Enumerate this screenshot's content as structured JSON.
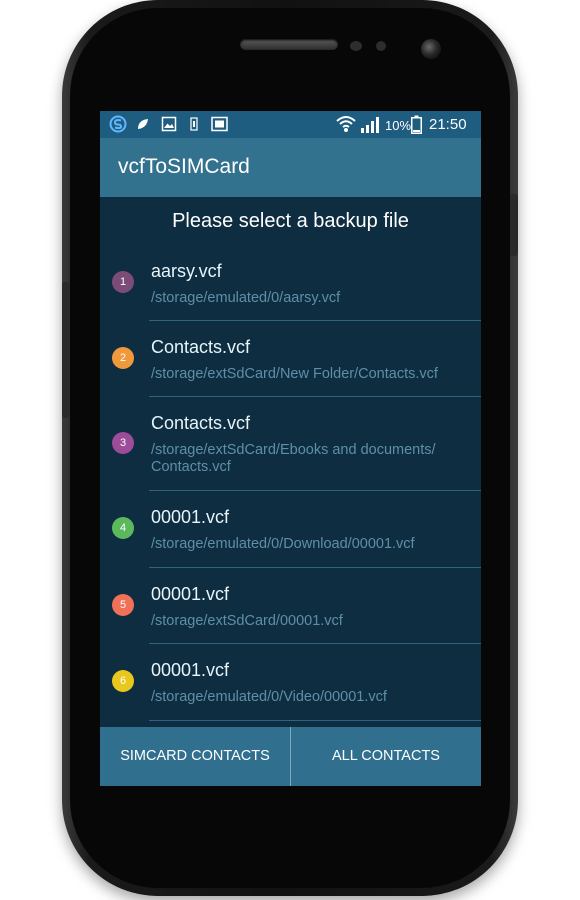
{
  "status_bar": {
    "time": "21:50",
    "battery": "10%",
    "icons": [
      "s-app-icon",
      "leaf-icon",
      "image-icon",
      "battery-saver-icon",
      "screenshot-icon",
      "wifi-icon",
      "signal-icon",
      "battery-icon"
    ]
  },
  "app": {
    "title": "vcfToSIMCard"
  },
  "prompt": "Please select a backup file",
  "files": [
    {
      "number": "1",
      "name": "aarsy.vcf",
      "path": "/storage/emulated/0/aarsy.vcf",
      "color": "#7c4c78"
    },
    {
      "number": "2",
      "name": "Contacts.vcf",
      "path": "/storage/extSdCard/New Folder/Contacts.vcf",
      "color": "#f0993c"
    },
    {
      "number": "3",
      "name": "Contacts.vcf",
      "path": "/storage/extSdCard/Ebooks and documents/ Contacts.vcf",
      "color": "#9c4c98"
    },
    {
      "number": "4",
      "name": "00001.vcf",
      "path": "/storage/emulated/0/Download/00001.vcf",
      "color": "#5cb85c"
    },
    {
      "number": "5",
      "name": "00001.vcf",
      "path": "/storage/extSdCard/00001.vcf",
      "color": "#f07058"
    },
    {
      "number": "6",
      "name": "00001.vcf",
      "path": "/storage/emulated/0/Video/00001.vcf",
      "color": "#e8c81c"
    }
  ],
  "buttons": {
    "sim_contacts": "SIMCARD CONTACTS",
    "all_contacts": "ALL CONTACTS"
  },
  "colors": {
    "status_bar": "#1e5c80",
    "app_bar": "#32728f",
    "background": "#0e2d40",
    "bottom_bar": "#30708e"
  }
}
